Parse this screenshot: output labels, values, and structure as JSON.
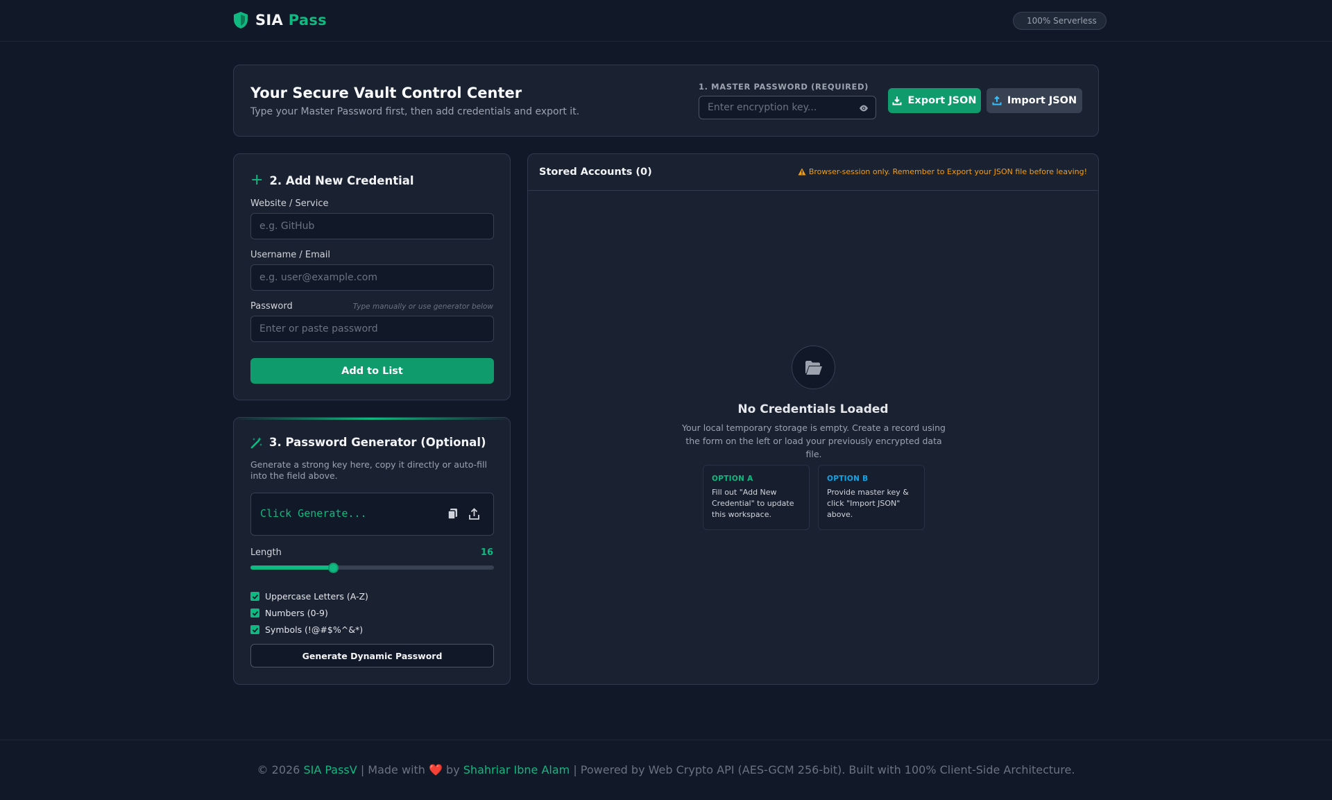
{
  "brand": {
    "name": "SIA",
    "accent": "Pass"
  },
  "header": {
    "badge": "100% Serverless"
  },
  "hero": {
    "title": "Your Secure Vault Control Center",
    "subtitle": "Type your Master Password first, then add credentials and export it.",
    "master_label": "1. MASTER PASSWORD (REQUIRED)",
    "master_placeholder": "Enter encryption key...",
    "export_label": "Export JSON",
    "import_label": "Import JSON"
  },
  "add_card": {
    "title": "2. Add New Credential",
    "website_label": "Website / Service",
    "website_placeholder": "e.g. GitHub",
    "username_label": "Username / Email",
    "username_placeholder": "e.g. user@example.com",
    "password_label": "Password",
    "password_hint": "Type manually or use generator below",
    "password_placeholder": "Enter or paste password",
    "add_button": "Add to List"
  },
  "generator": {
    "title": "3. Password Generator (Optional)",
    "description": "Generate a strong key here, copy it directly or auto-fill into the field above.",
    "output": "Click Generate...",
    "length_label": "Length",
    "length_value": "16",
    "length_fraction": 0.34,
    "options": [
      {
        "label": "Uppercase Letters (A-Z)",
        "checked": true
      },
      {
        "label": "Numbers (0-9)",
        "checked": true
      },
      {
        "label": "Symbols (!@#$%^&*)",
        "checked": true
      }
    ],
    "generate_button": "Generate Dynamic Password"
  },
  "stored": {
    "title": "Stored Accounts (0)",
    "warning": "Browser-session only. Remember to Export your JSON file before leaving!",
    "empty_title": "No Credentials Loaded",
    "empty_desc": "Your local temporary storage is empty. Create a record using the form on the left or load your previously encrypted data file.",
    "option_a_title": "OPTION A",
    "option_a_text": "Fill out \"Add New Credential\" to update this workspace.",
    "option_b_title": "OPTION B",
    "option_b_text": "Provide master key & click \"Import JSON\" above."
  },
  "footer": {
    "copyright": "© 2026",
    "app_link": "SIA PassV",
    "made_with": "| Made with",
    "heart": "❤️",
    "by": "by",
    "author_link": "Shahriar Ibne Alam",
    "powered": "| Powered by Web Crypto API (AES-GCM 256-bit). Built with 100% Client-Side Architecture."
  },
  "colors": {
    "background": "#111827",
    "card": "#1a2232",
    "accent": "#10b981",
    "button_primary": "#0f9b6c",
    "warning": "#f59e0b",
    "info": "#0ea5e9"
  },
  "icons": {
    "brand": "shield-icon",
    "eye": "eye-icon",
    "export": "download-icon",
    "import": "upload-icon",
    "add": "plus-icon",
    "generator": "magic-wand-icon",
    "copy": "copy-icon",
    "fill": "share-upload-icon",
    "warning": "warning-triangle-icon",
    "empty": "folder-open-icon"
  }
}
